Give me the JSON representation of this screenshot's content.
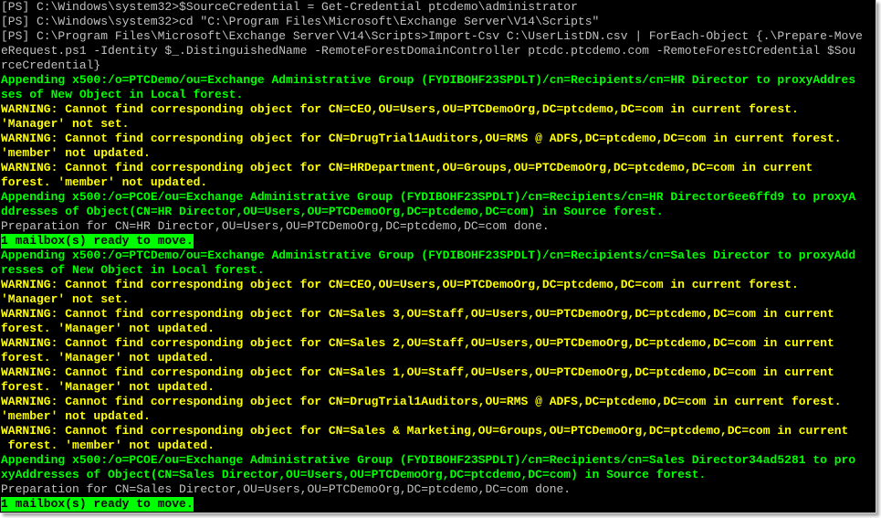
{
  "lines": [
    {
      "c": "w",
      "t": "[PS] C:\\Windows\\system32>$SourceCredential = Get-Credential ptcdemo\\administrator"
    },
    {
      "c": "w",
      "t": "[PS] C:\\Windows\\system32>cd \"C:\\Program Files\\Microsoft\\Exchange Server\\V14\\Scripts\""
    },
    {
      "c": "w",
      "t": "[PS] C:\\Program Files\\Microsoft\\Exchange Server\\V14\\Scripts>Import-Csv C:\\UserListDN.csv | ForEach-Object {.\\Prepare-Move"
    },
    {
      "c": "w",
      "t": "eRequest.ps1 -Identity $_.DistinguishedName -RemoteForestDomainController ptcdc.ptcdemo.com -RemoteForestCredential $Sou"
    },
    {
      "c": "w",
      "t": "rceCredential}"
    },
    {
      "c": "g",
      "t": "Appending x500:/o=PTCDemo/ou=Exchange Administrative Group (FYDIBOHF23SPDLT)/cn=Recipients/cn=HR Director to proxyAddres"
    },
    {
      "c": "g",
      "t": "ses of New Object in Local forest."
    },
    {
      "c": "y",
      "t": "WARNING: Cannot find corresponding object for CN=CEO,OU=Users,OU=PTCDemoOrg,DC=ptcdemo,DC=com in current forest."
    },
    {
      "c": "y",
      "t": "'Manager' not set."
    },
    {
      "c": "y",
      "t": "WARNING: Cannot find corresponding object for CN=DrugTrial1Auditors,OU=RMS @ ADFS,DC=ptcdemo,DC=com in current forest."
    },
    {
      "c": "y",
      "t": "'member' not updated."
    },
    {
      "c": "y",
      "t": "WARNING: Cannot find corresponding object for CN=HRDepartment,OU=Groups,OU=PTCDemoOrg,DC=ptcdemo,DC=com in current"
    },
    {
      "c": "y",
      "t": "forest. 'member' not updated."
    },
    {
      "c": "g",
      "t": "Appending x500:/o=PCOE/ou=Exchange Administrative Group (FYDIBOHF23SPDLT)/cn=Recipients/cn=HR Director6ee6ffd9 to proxyA"
    },
    {
      "c": "g",
      "t": "ddresses of Object(CN=HR Director,OU=Users,OU=PTCDemoOrg,DC=ptcdemo,DC=com) in Source forest."
    },
    {
      "c": "w",
      "t": "Preparation for CN=HR Director,OU=Users,OU=PTCDemoOrg,DC=ptcdemo,DC=com done."
    },
    {
      "c": "hl",
      "t": "1 mailbox(s) ready to move."
    },
    {
      "c": "g",
      "t": "Appending x500:/o=PTCDemo/ou=Exchange Administrative Group (FYDIBOHF23SPDLT)/cn=Recipients/cn=Sales Director to proxyAdd"
    },
    {
      "c": "g",
      "t": "resses of New Object in Local forest."
    },
    {
      "c": "y",
      "t": "WARNING: Cannot find corresponding object for CN=CEO,OU=Users,OU=PTCDemoOrg,DC=ptcdemo,DC=com in current forest."
    },
    {
      "c": "y",
      "t": "'Manager' not set."
    },
    {
      "c": "y",
      "t": "WARNING: Cannot find corresponding object for CN=Sales 3,OU=Staff,OU=Users,OU=PTCDemoOrg,DC=ptcdemo,DC=com in current"
    },
    {
      "c": "y",
      "t": "forest. 'Manager' not updated."
    },
    {
      "c": "y",
      "t": "WARNING: Cannot find corresponding object for CN=Sales 2,OU=Staff,OU=Users,OU=PTCDemoOrg,DC=ptcdemo,DC=com in current"
    },
    {
      "c": "y",
      "t": "forest. 'Manager' not updated."
    },
    {
      "c": "y",
      "t": "WARNING: Cannot find corresponding object for CN=Sales 1,OU=Staff,OU=Users,OU=PTCDemoOrg,DC=ptcdemo,DC=com in current"
    },
    {
      "c": "y",
      "t": "forest. 'Manager' not updated."
    },
    {
      "c": "y",
      "t": "WARNING: Cannot find corresponding object for CN=DrugTrial1Auditors,OU=RMS @ ADFS,DC=ptcdemo,DC=com in current forest."
    },
    {
      "c": "y",
      "t": "'member' not updated."
    },
    {
      "c": "y",
      "t": "WARNING: Cannot find corresponding object for CN=Sales & Marketing,OU=Groups,OU=PTCDemoOrg,DC=ptcdemo,DC=com in current"
    },
    {
      "c": "y",
      "t": " forest. 'member' not updated."
    },
    {
      "c": "g",
      "t": "Appending x500:/o=PCOE/ou=Exchange Administrative Group (FYDIBOHF23SPDLT)/cn=Recipients/cn=Sales Director34ad5281 to pro"
    },
    {
      "c": "g",
      "t": "xyAddresses of Object(CN=Sales Director,OU=Users,OU=PTCDemoOrg,DC=ptcdemo,DC=com) in Source forest."
    },
    {
      "c": "w",
      "t": "Preparation for CN=Sales Director,OU=Users,OU=PTCDemoOrg,DC=ptcdemo,DC=com done."
    },
    {
      "c": "hl",
      "t": "1 mailbox(s) ready to move."
    }
  ],
  "colors": {
    "background": "#000000",
    "normal_text": "#c0c0c0",
    "warning_text": "#ffff00",
    "info_text": "#00ff00",
    "highlight_bg": "#00ff00"
  }
}
